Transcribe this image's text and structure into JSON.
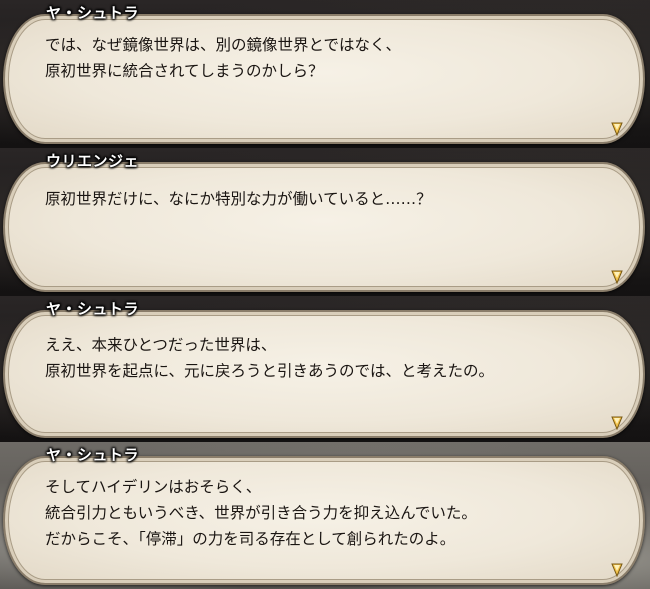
{
  "dialogues": [
    {
      "speaker": "ヤ・シュトラ",
      "lines": [
        "では、なぜ鏡像世界は、別の鏡像世界とではなく、",
        "原初世界に統合されてしまうのかしら？"
      ]
    },
    {
      "speaker": "ウリエンジェ",
      "lines": [
        "原初世界だけに、なにか特別な力が働いていると……？"
      ]
    },
    {
      "speaker": "ヤ・シュトラ",
      "lines": [
        "ええ、本来ひとつだった世界は、",
        "原初世界を起点に、元に戻ろうと引きあうのでは、と考えたの。"
      ]
    },
    {
      "speaker": "ヤ・シュトラ",
      "lines": [
        "そしてハイデリンはおそらく、",
        "統合引力ともいうべき、世界が引き合う力を抑え込んでいた。",
        "だからこそ、「停滞」の力を司る存在として創られたのよ。"
      ]
    }
  ],
  "colors": {
    "box_fill": "#efe8da",
    "box_border": "#8a7d6a",
    "text": "#1a1512",
    "speaker": "#ffffff",
    "cursor": "#f2c24a"
  },
  "icons": {
    "advance": "advance-cursor-icon"
  }
}
